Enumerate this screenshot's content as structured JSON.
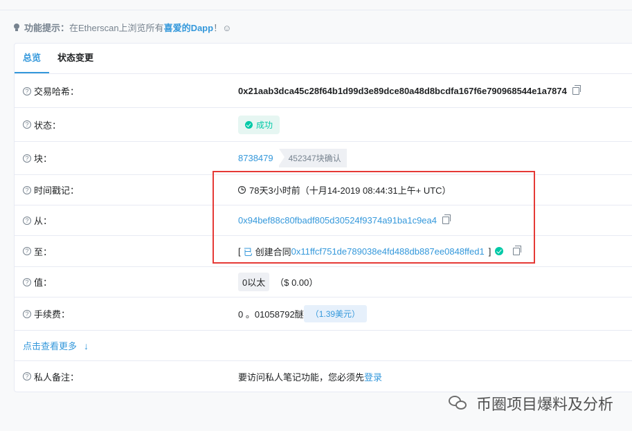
{
  "tip": {
    "label": "功能提示：",
    "text": "在Etherscan上浏览所有",
    "link": "喜爱的Dapp",
    "end": "！☺"
  },
  "tabs": [
    {
      "label": "总览",
      "active": true
    },
    {
      "label": "状态变更",
      "active": false
    }
  ],
  "rows": {
    "txhash": {
      "label": "交易哈希：",
      "value": "0x21aab3dca45c28f64b1d99d3e89dce80a48d8bcdfa167f6e790968544e1a7874"
    },
    "status": {
      "label": "状态：",
      "value": "成功"
    },
    "block": {
      "label": "块：",
      "value": "8738479",
      "confirmations": "452347块确认"
    },
    "timestamp": {
      "label": "时间戳记：",
      "value": "78天3小时前（十月14-2019 08:44:31上午+ UTC）"
    },
    "from": {
      "label": "从：",
      "value": "0x94bef88c80fbadf805d30524f9374a91ba1c9ea4"
    },
    "to": {
      "label": "至：",
      "bracket_open": "[",
      "prefix": "已",
      "created": "创建合同",
      "value": "0x11ffcf751de789038e4fd488db887ee0848ffed1",
      "bracket_close": "]"
    },
    "value": {
      "label": "值：",
      "amount": "0以太",
      "usd": "（$ 0.00）"
    },
    "fee": {
      "label": "手续费：",
      "amount": "0 。01058792醚",
      "usd": "（1.39美元）"
    },
    "more": {
      "label": "点击查看更多",
      "arrow": "↓"
    },
    "note": {
      "label": "私人备注：",
      "text": "要访问私人笔记功能，您必须先",
      "link": "登录"
    }
  },
  "watermark": "币圈项目爆料及分析",
  "colors": {
    "accent": "#3498db",
    "success": "#00c9a7",
    "highlight": "#e53935"
  }
}
